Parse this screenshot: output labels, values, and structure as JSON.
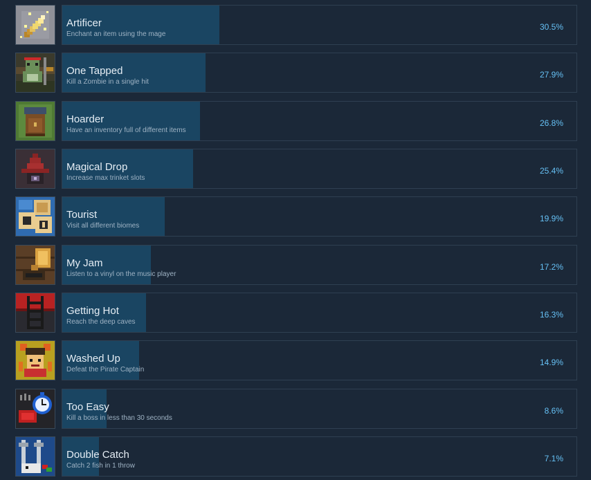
{
  "achievements": [
    {
      "name": "Artificer",
      "description": "Enchant an item using the mage",
      "percent_label": "30.5%",
      "percent": 30.5,
      "icon": "sword-sparkle-icon"
    },
    {
      "name": "One Tapped",
      "description": "Kill a Zombie in a single hit",
      "percent_label": "27.9%",
      "percent": 27.9,
      "icon": "zombie-icon"
    },
    {
      "name": "Hoarder",
      "description": "Have an inventory full of different items",
      "percent_label": "26.8%",
      "percent": 26.8,
      "icon": "backpack-icon"
    },
    {
      "name": "Magical Drop",
      "description": "Increase max trinket slots",
      "percent_label": "25.4%",
      "percent": 25.4,
      "icon": "wizard-hat-icon"
    },
    {
      "name": "Tourist",
      "description": "Visit all different biomes",
      "percent_label": "19.9%",
      "percent": 19.9,
      "icon": "map-icon"
    },
    {
      "name": "My Jam",
      "description": "Listen to a vinyl on the music player",
      "percent_label": "17.2%",
      "percent": 17.2,
      "icon": "gramophone-icon"
    },
    {
      "name": "Getting Hot",
      "description": "Reach the deep caves",
      "percent_label": "16.3%",
      "percent": 16.3,
      "icon": "ladder-icon"
    },
    {
      "name": "Washed Up",
      "description": "Defeat the Pirate Captain",
      "percent_label": "14.9%",
      "percent": 14.9,
      "icon": "pirate-captain-icon"
    },
    {
      "name": "Too Easy",
      "description": "Kill a boss in less than 30 seconds",
      "percent_label": "8.6%",
      "percent": 8.6,
      "icon": "stopwatch-icon"
    },
    {
      "name": "Double Catch",
      "description": "Catch 2 fish in 1 throw",
      "percent_label": "7.1%",
      "percent": 7.1,
      "icon": "fish-icon"
    }
  ]
}
